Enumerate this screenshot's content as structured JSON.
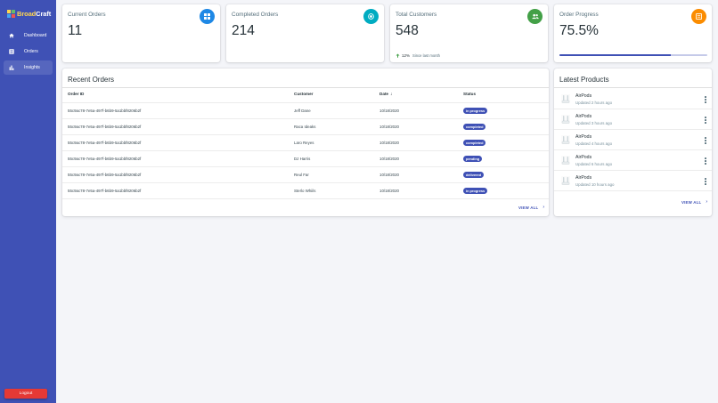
{
  "brand": {
    "part1": "Broad",
    "part2": "Craft"
  },
  "sidebar": {
    "items": [
      {
        "label": "Dashboard",
        "icon": "home-icon"
      },
      {
        "label": "Orders",
        "icon": "list-icon"
      },
      {
        "label": "Insights",
        "icon": "bar-chart-icon"
      }
    ],
    "logout": "Logout"
  },
  "stats": {
    "current_orders": {
      "title": "Current Orders",
      "value": "11",
      "icon": "grid-icon",
      "color": "#1e88e5"
    },
    "completed_orders": {
      "title": "Completed Orders",
      "value": "214",
      "icon": "target-icon",
      "color": "#00acc1"
    },
    "total_customers": {
      "title": "Total Customers",
      "value": "548",
      "icon": "people-icon",
      "color": "#43a047",
      "change": "12%",
      "change_note": "Since last month"
    },
    "order_progress": {
      "title": "Order Progress",
      "value": "75.5%",
      "icon": "list-box-icon",
      "color": "#fb8c00",
      "progress": 0.755
    }
  },
  "recent_orders": {
    "title": "Recent Orders",
    "columns": {
      "id": "Order ID",
      "customer": "Customer",
      "date": "Date",
      "status": "Status"
    },
    "rows": [
      {
        "id": "55c9ac78-7e5a-497f-b6b9-5a1bbf8206b2f",
        "customer": "Jeff Dane",
        "date": "10/18/2020",
        "status": "in progress"
      },
      {
        "id": "55c9ac78-7e5a-497f-b6b9-5a1bbf8206b2f",
        "customer": "Raca Ideaks",
        "date": "10/18/2020",
        "status": "completed"
      },
      {
        "id": "55c9ac78-7e5a-497f-b6b9-5a1bbf8206b2f",
        "customer": "Laro Reyes",
        "date": "10/18/2020",
        "status": "completed"
      },
      {
        "id": "55c9ac78-7e5a-497f-b6b9-5a1bbf8206b2f",
        "customer": "DJ Harris",
        "date": "10/18/2020",
        "status": "pending"
      },
      {
        "id": "55c9ac78-7e5a-497f-b6b9-5a1bbf8206b2f",
        "customer": "Reul Far",
        "date": "10/18/2020",
        "status": "delivered"
      },
      {
        "id": "55c9ac78-7e5a-497f-b6b9-5a1bbf8206b2f",
        "customer": "Sterlo Whiils",
        "date": "10/18/2020",
        "status": "in progress"
      }
    ],
    "view_all": "VIEW ALL"
  },
  "latest_products": {
    "title": "Latest Products",
    "items": [
      {
        "name": "AirPods",
        "updated": "Updated 2 hours ago"
      },
      {
        "name": "AirPods",
        "updated": "Updated 3 hours ago"
      },
      {
        "name": "AirPods",
        "updated": "Updated 4 hours ago"
      },
      {
        "name": "AirPods",
        "updated": "Updated 6 hours ago"
      },
      {
        "name": "AirPods",
        "updated": "Updated 10 hours ago"
      }
    ],
    "view_all": "VIEW ALL"
  }
}
